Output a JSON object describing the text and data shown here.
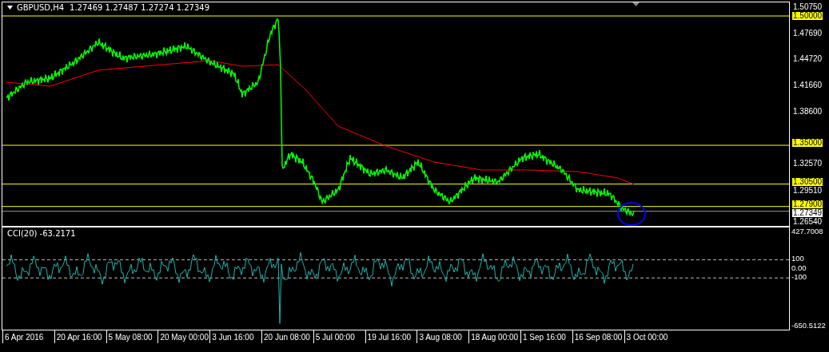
{
  "chart_header": {
    "symbol": "GBPUSD,H4",
    "ohlc": "1.27469 1.27487 1.27274 1.27349"
  },
  "price_axis": [
    "1.50750",
    "1.47690",
    "1.44720",
    "1.41660",
    "1.38600",
    "1.32570",
    "1.29510",
    "1.26540"
  ],
  "horizontal_lines": [
    "1.50000",
    "1.35000",
    "1.30500",
    "1.27900"
  ],
  "current_price": "1.27349",
  "indicator": {
    "title": "CCI(20) -63.2171",
    "axis": [
      "427.7008",
      "100",
      "0.00",
      "-100",
      "-650.5122"
    ]
  },
  "time_axis": [
    "6 Apr 2016",
    "20 Apr 16:00",
    "5 May 08:00",
    "20 May 00:00",
    "3 Jun 16:00",
    "20 Jun 08:00",
    "5 Jul 00:00",
    "19 Jul 16:00",
    "3 Aug 08:00",
    "18 Aug 00:00",
    "1 Sep 16:00",
    "16 Sep 08:00",
    "3 Oct 00:00"
  ]
}
